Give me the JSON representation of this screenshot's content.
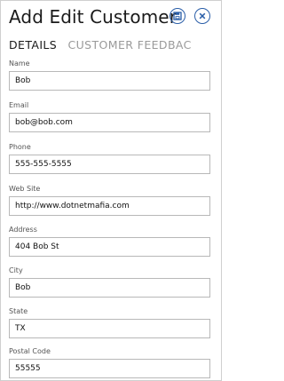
{
  "header": {
    "title": "Add Edit Customer",
    "save_icon": "save-icon",
    "cancel_icon": "close-icon",
    "accent_color": "#2a5ea8"
  },
  "tabs": [
    {
      "label": "DETAILS",
      "active": true
    },
    {
      "label": "CUSTOMER FEEDBAC",
      "active": false
    }
  ],
  "form": {
    "fields": [
      {
        "label": "Name",
        "value": "Bob"
      },
      {
        "label": "Email",
        "value": "bob@bob.com"
      },
      {
        "label": "Phone",
        "value": "555-555-5555"
      },
      {
        "label": "Web Site",
        "value": "http://www.dotnetmafia.com"
      },
      {
        "label": "Address",
        "value": "404 Bob St"
      },
      {
        "label": "City",
        "value": "Bob"
      },
      {
        "label": "State",
        "value": "TX"
      },
      {
        "label": "Postal Code",
        "value": "55555"
      }
    ]
  }
}
